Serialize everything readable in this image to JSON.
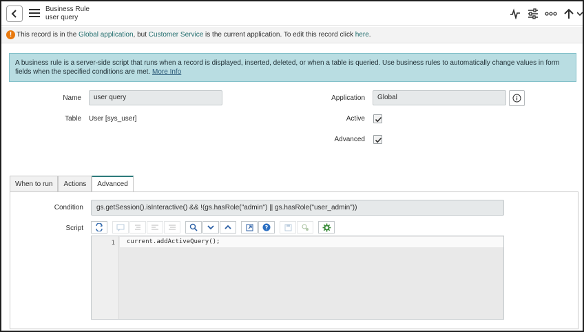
{
  "header": {
    "title": "Business Rule",
    "subtitle": "user query",
    "icons": [
      "back-chevron-icon",
      "hamburger-menu-icon",
      "activity-stream-icon",
      "settings-sliders-icon",
      "more-options-icon",
      "scroll-up-arrow-icon",
      "dropdown-chevron-icon"
    ]
  },
  "warning": {
    "prefix": "This record is in the ",
    "scope_link": "Global application",
    "middle": ", but ",
    "app_link": "Customer Service",
    "suffix": " is the current application. To edit this record click ",
    "here_link": "here",
    "end": ".",
    "accent": "#e8790e"
  },
  "info": {
    "text": "A business rule is a server-side script that runs when a record is displayed, inserted, deleted, or when a table is queried. Use business rules to automatically change values in form fields when the specified conditions are met.",
    "more_link": "More Info"
  },
  "form": {
    "name_label": "Name",
    "name_value": "user query",
    "table_label": "Table",
    "table_value": "User [sys_user]",
    "application_label": "Application",
    "application_value": "Global",
    "active_label": "Active",
    "active_checked": true,
    "advanced_label": "Advanced",
    "advanced_checked": true
  },
  "tabs": [
    {
      "label": "When to run",
      "active": false
    },
    {
      "label": "Actions",
      "active": false
    },
    {
      "label": "Advanced",
      "active": true
    }
  ],
  "advanced": {
    "condition_label": "Condition",
    "condition_value": "gs.getSession().isInteractive() && !(gs.hasRole(\"admin\") || gs.hasRole(\"user_admin\"))",
    "script_label": "Script",
    "code_lines": [
      {
        "number": "1",
        "text": "current.addActiveQuery();"
      }
    ]
  },
  "colors": {
    "info_bg": "#b9dde2",
    "tab_accent": "#2c7a7b",
    "link": "#1f6c6c"
  }
}
